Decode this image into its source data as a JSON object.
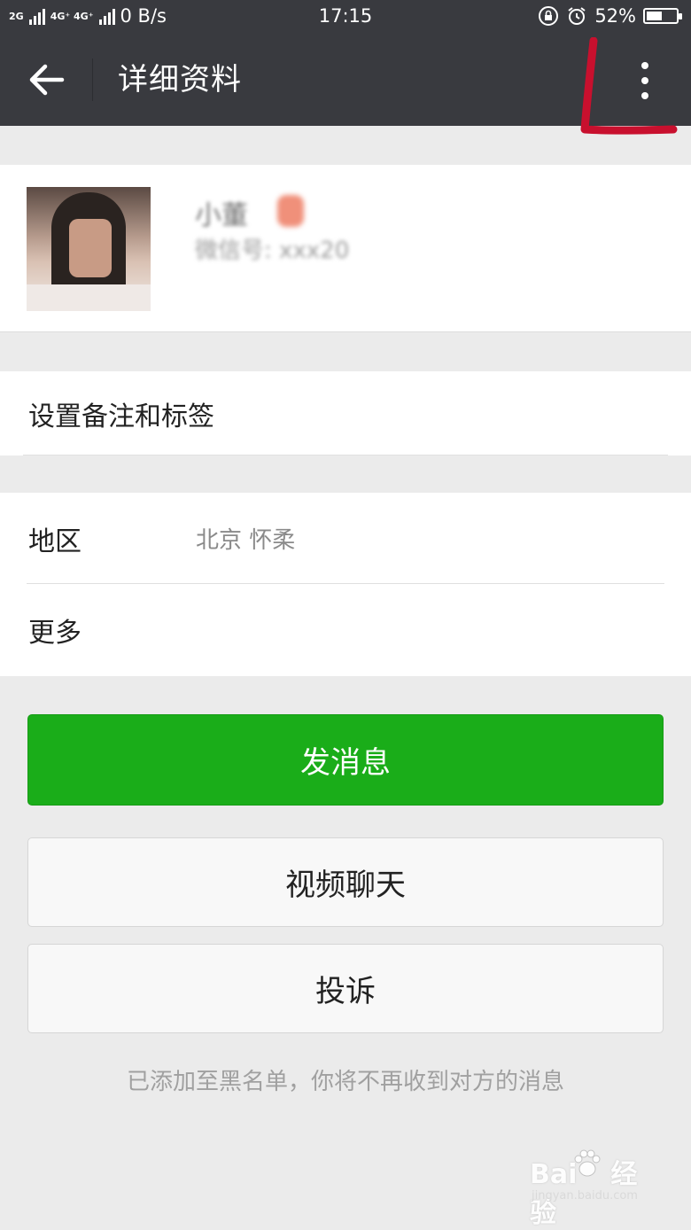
{
  "status_bar": {
    "network_1": "2G",
    "network_2": "4G⁺ 4G⁺",
    "speed": "0 B/s",
    "time": "17:15",
    "battery_percent": "52%",
    "battery_level": 0.52
  },
  "header": {
    "title": "详细资料",
    "back_icon": "arrow-left-icon",
    "more_icon": "more-vertical-icon"
  },
  "profile": {
    "nickname": "小董",
    "wechat_id": "微信号: xxx20"
  },
  "remark": {
    "label": "设置备注和标签"
  },
  "info": {
    "region_label": "地区",
    "region_value": "北京  怀柔",
    "more_label": "更多"
  },
  "actions": {
    "send_message": "发消息",
    "video_chat": "视频聊天",
    "report": "投诉"
  },
  "notice": "已添加至黑名单，你将不再收到对方的消息",
  "watermark": {
    "brand": "Bai",
    "brand_tail": "经验",
    "url": "jingyan.baidu.com"
  },
  "colors": {
    "header_bg": "#393a3f",
    "primary_green": "#1aad19",
    "annotation_red": "#c8102e"
  }
}
